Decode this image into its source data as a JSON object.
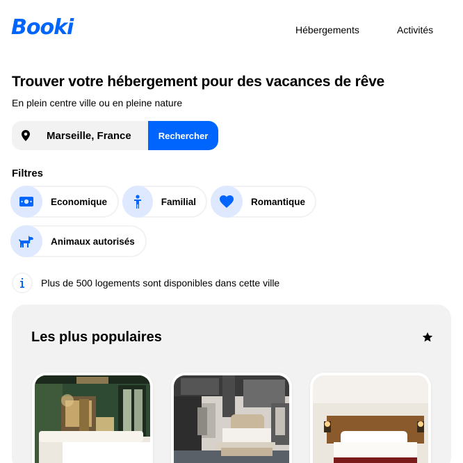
{
  "brand": {
    "logo_text": "Booki",
    "accent": "#0065fc"
  },
  "nav": {
    "items": [
      "Hébergements",
      "Activités"
    ]
  },
  "hero": {
    "title": "Trouver votre hébergement pour des vacances de rêve",
    "subtitle": "En plein centre ville ou en pleine nature"
  },
  "search": {
    "value": "Marseille, France",
    "button_label": "Rechercher",
    "icon": "location-pin-icon"
  },
  "filters": {
    "label": "Filtres",
    "items": [
      {
        "label": "Economique",
        "icon": "money-icon"
      },
      {
        "label": "Familial",
        "icon": "child-icon"
      },
      {
        "label": "Romantique",
        "icon": "heart-icon"
      },
      {
        "label": "Animaux autorisés",
        "icon": "dog-icon"
      }
    ]
  },
  "info": {
    "text": "Plus de 500 logements sont disponibles dans cette ville",
    "icon": "info-icon"
  },
  "popular": {
    "title": "Les plus populaires",
    "icon": "star-icon",
    "cards": [
      {
        "image": "hotel-room-green-photo"
      },
      {
        "image": "hotel-room-loft-photo"
      },
      {
        "image": "hotel-room-wood-photo"
      }
    ]
  }
}
